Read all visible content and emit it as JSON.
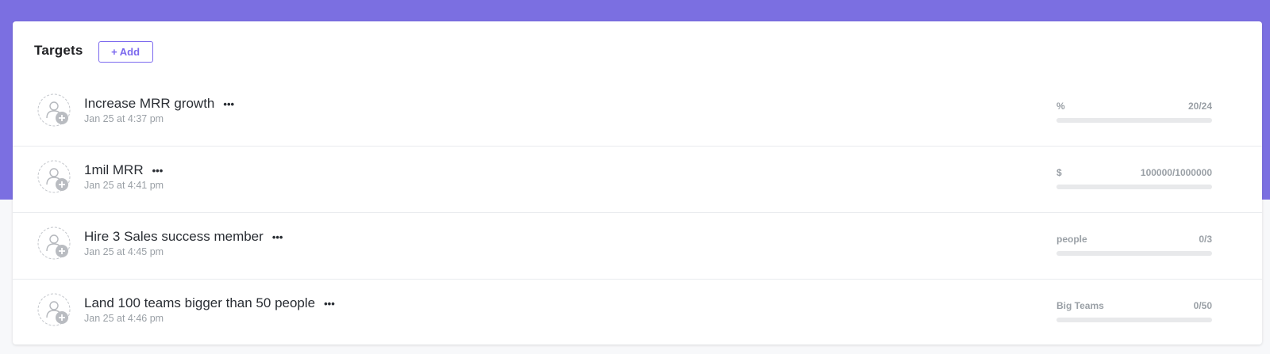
{
  "header": {
    "title": "Targets",
    "add_label": "+ Add"
  },
  "colors": {
    "banner": "#7b6fe1",
    "accent": "#7b68ee"
  },
  "targets": [
    {
      "name": "Increase MRR growth",
      "more": "•••",
      "date": "Jan 25 at 4:37 pm",
      "unit": "%",
      "progress_text": "20/24",
      "current": 20,
      "target": 24
    },
    {
      "name": "1mil MRR",
      "more": "•••",
      "date": "Jan 25 at 4:41 pm",
      "unit": "$",
      "progress_text": "100000/1000000",
      "current": 100000,
      "target": 1000000
    },
    {
      "name": "Hire 3 Sales success member",
      "more": "•••",
      "date": "Jan 25 at 4:45 pm",
      "unit": "people",
      "progress_text": "0/3",
      "current": 0,
      "target": 3
    },
    {
      "name": "Land 100 teams bigger than 50 people",
      "more": "•••",
      "date": "Jan 25 at 4:46 pm",
      "unit": "Big Teams",
      "progress_text": "0/50",
      "current": 0,
      "target": 50
    }
  ]
}
